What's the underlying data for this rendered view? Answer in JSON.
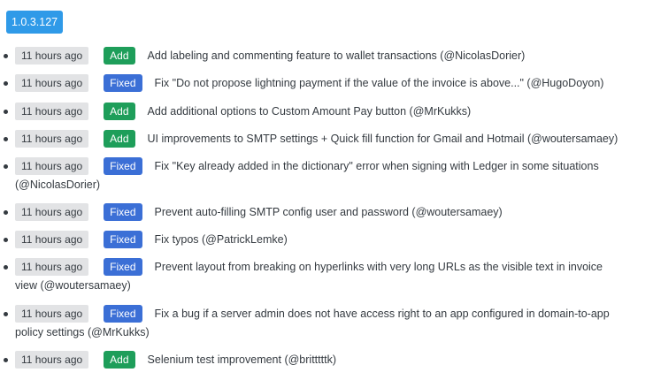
{
  "release": {
    "version": "1.0.3.127"
  },
  "entries": [
    {
      "time": "11 hours ago",
      "type": "Add",
      "text": "Add labeling and commenting feature to wallet transactions (@NicolasDorier)"
    },
    {
      "time": "11 hours ago",
      "type": "Fixed",
      "text": "Fix \"Do not propose lightning payment if the value of the invoice is above...\" (@HugoDoyon)"
    },
    {
      "time": "11 hours ago",
      "type": "Add",
      "text": "Add additional options to Custom Amount Pay button (@MrKukks)"
    },
    {
      "time": "11 hours ago",
      "type": "Add",
      "text": "UI improvements to SMTP settings + Quick fill function for Gmail and Hotmail (@woutersamaey)"
    },
    {
      "time": "11 hours ago",
      "type": "Fixed",
      "text": "Fix \"Key already added in the dictionary\" error when signing with Ledger in some situations (@NicolasDorier)"
    },
    {
      "time": "11 hours ago",
      "type": "Fixed",
      "text": "Prevent auto-filling SMTP config user and password (@woutersamaey)"
    },
    {
      "time": "11 hours ago",
      "type": "Fixed",
      "text": "Fix typos (@PatrickLemke)"
    },
    {
      "time": "11 hours ago",
      "type": "Fixed",
      "text": "Prevent layout from breaking on hyperlinks with very long URLs as the visible text in invoice view (@woutersamaey)"
    },
    {
      "time": "11 hours ago",
      "type": "Fixed",
      "text": "Fix a bug if a server admin does not have access right to an app configured in domain-to-app policy settings (@MrKukks)"
    },
    {
      "time": "11 hours ago",
      "type": "Add",
      "text": "Selenium test improvement (@britttttk)"
    }
  ],
  "colors": {
    "version_badge": "#2f9ae8",
    "add_badge": "#1e9e5a",
    "fixed_badge": "#3b6fd6",
    "time_badge": "#e2e3e5"
  }
}
